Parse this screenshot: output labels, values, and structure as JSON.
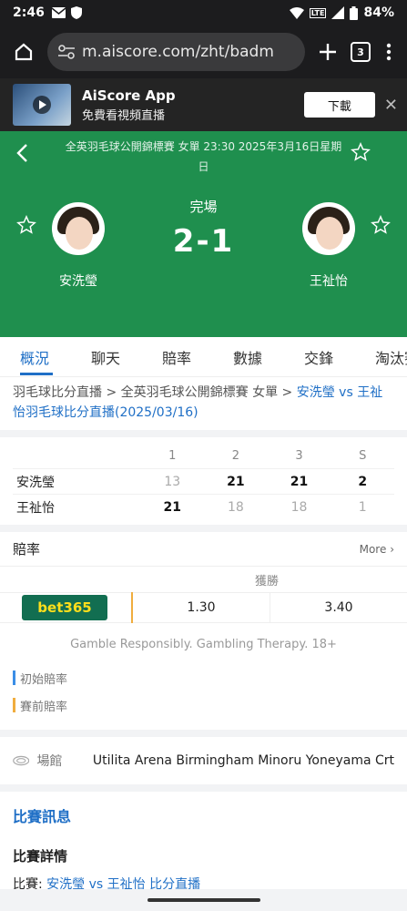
{
  "status_bar": {
    "time": "2:46",
    "battery": "84%",
    "lte": "LTE"
  },
  "browser": {
    "url": "m.aiscore.com/zht/badm",
    "tab_count": "3"
  },
  "app_banner": {
    "title": "AiScore App",
    "subtitle": "免費看視頻直播",
    "download": "下載",
    "close": "✕"
  },
  "match": {
    "info": "全英羽毛球公開錦標賽 女單 23:30 2025年3月16日星期日",
    "status": "完場",
    "score": "2-1",
    "player1": "安洗瑩",
    "player2": "王祉怡"
  },
  "tabs": [
    "概況",
    "聊天",
    "賠率",
    "數據",
    "交鋒",
    "淘汰賽"
  ],
  "breadcrumb": {
    "part1": "羽毛球比分直播",
    "sep": " > ",
    "part2": "全英羽毛球公開錦標賽 女單",
    "link": "安洗瑩 vs 王祉怡羽毛球比分直播(2025/03/16)"
  },
  "score_table": {
    "headers": [
      "1",
      "2",
      "3",
      "S"
    ],
    "rows": [
      {
        "name": "安洗瑩",
        "values": [
          "13",
          "21",
          "21",
          "2"
        ]
      },
      {
        "name": "王祉怡",
        "values": [
          "21",
          "18",
          "18",
          "1"
        ]
      }
    ]
  },
  "odds": {
    "title": "賠率",
    "more": "More",
    "win_label": "獲勝",
    "bookmaker": "bet365",
    "home": "1.30",
    "away": "3.40",
    "gamble_note": "Gamble Responsibly. Gambling Therapy. 18+",
    "legend_initial": "初始賠率",
    "legend_pre": "賽前賠率"
  },
  "venue": {
    "label": "場館",
    "value": "Utilita Arena Birmingham Minoru Yoneyama Crt"
  },
  "match_info": {
    "heading": "比賽訊息",
    "details_heading": "比賽詳情",
    "match_prefix": "比賽: ",
    "match_link": "安洗瑩 vs 王祉怡 比分直播"
  },
  "colors": {
    "header_green": "#1f8f4e",
    "link_blue": "#1f6fc6",
    "bet365_green": "#126e51",
    "bet365_yellow": "#ffdf1b"
  }
}
